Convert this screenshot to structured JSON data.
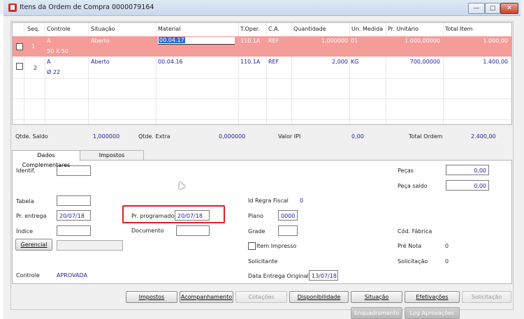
{
  "window": {
    "title": "Itens da Ordem de Compra 0000079164",
    "minimize": "—",
    "maximize": "▢",
    "close": "✕"
  },
  "grid": {
    "headers": [
      "Seq.",
      "Controle",
      "Situação",
      "Material",
      "T.Oper.",
      "C.A.",
      "Quantidade",
      "Un. Medida",
      "Pr. Unitário",
      "Total Item"
    ],
    "rows": [
      {
        "seq": "1",
        "controle": "A",
        "controle2": "50 X 50",
        "situacao": "Aberto",
        "material": "00.04.17",
        "toper": "110.1A",
        "ca": "REF",
        "quantidade": "1,000000",
        "un": "01",
        "pr_unit": "1.000,00000",
        "total": "1.000,00",
        "selected": true
      },
      {
        "seq": "2",
        "controle": "A",
        "controle2": "Ø 22",
        "situacao": "Aberto",
        "material": "00.04.16",
        "toper": "110.1A",
        "ca": "REF",
        "quantidade": "2,000",
        "un": "KG",
        "pr_unit": "700,00000",
        "total": "1.400,00",
        "selected": false
      }
    ]
  },
  "totals": {
    "saldo_label": "Qtde. Saldo",
    "saldo_value": "1,000000",
    "extra_label": "Qtde. Extra",
    "extra_value": "0,000000",
    "ipi_label": "Valor IPI",
    "ipi_value": "0,00",
    "ordem_label": "Total Ordem",
    "ordem_value": "2.400,00"
  },
  "tabs": [
    {
      "label": "Dados Complementares"
    },
    {
      "label": "Impostos"
    }
  ],
  "form": {
    "identif_label": "Identif.",
    "tabela_label": "Tabela",
    "entrega_label": "Pr. entrega",
    "entrega_value": "20/07/18",
    "programado_label": "Pr. programado",
    "programado_value": "20/07/18",
    "indice_label": "Índice",
    "documento_label": "Documento",
    "gerencial_label": "Gerencial",
    "controle_label": "Controle",
    "controle_value": "APROVADA",
    "id_regra_label": "Id Regra Fiscal",
    "id_regra_value": "0",
    "plano_label": "Plano",
    "plano_value": "0000",
    "grade_label": "Grade",
    "item_impresso_label": "Item Impresso",
    "solicitante_label": "Solicitante",
    "data_entrega_label": "Data Entrega Original",
    "data_entrega_value": "13/07/18",
    "pecas_label": "Peças",
    "pecas_value": "0,00",
    "peca_saldo_label": "Peça saldo",
    "peca_saldo_value": "0,00",
    "cod_fabrica_label": "Cód. Fábrica",
    "pre_nota_label": "Pré Nota",
    "pre_nota_value": "0",
    "solicitacao_label": "Solicitação",
    "solicitacao_value": "0"
  },
  "buttons": {
    "impostos": "Impostos",
    "acompanhamento": "Acompanhamento",
    "cotacoes": "Cotações",
    "disponibilidade": "Disponibilidade",
    "situacao": "Situação",
    "efetivacoes": "Efetivações",
    "solicitacao": "Solicitação",
    "enquadramento": "Enquadramento",
    "log_aprovacoes": "Log Aprovações"
  }
}
